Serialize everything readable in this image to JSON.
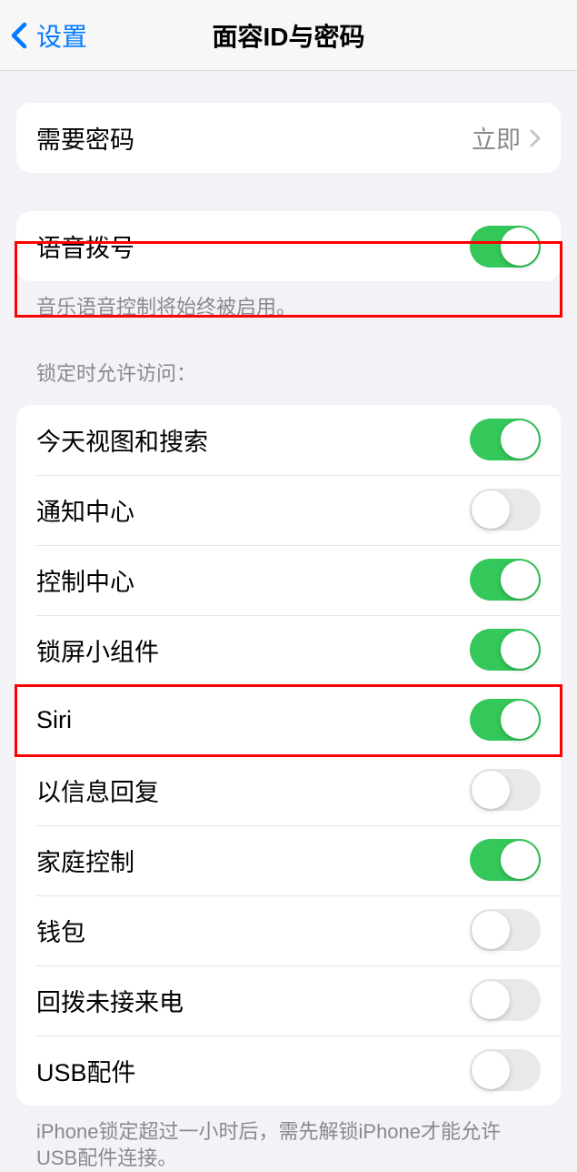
{
  "header": {
    "back_label": "设置",
    "title": "面容ID与密码"
  },
  "passcode_group": {
    "require_passcode": {
      "label": "需要密码",
      "value": "立即"
    }
  },
  "voice_dial": {
    "label": "语音拨号",
    "on": true,
    "footer": "音乐语音控制将始终被启用。"
  },
  "locked_access": {
    "header": "锁定时允许访问：",
    "items": [
      {
        "label": "今天视图和搜索",
        "on": true
      },
      {
        "label": "通知中心",
        "on": false
      },
      {
        "label": "控制中心",
        "on": true
      },
      {
        "label": "锁屏小组件",
        "on": true
      },
      {
        "label": "Siri",
        "on": true
      },
      {
        "label": "以信息回复",
        "on": false
      },
      {
        "label": "家庭控制",
        "on": true
      },
      {
        "label": "钱包",
        "on": false
      },
      {
        "label": "回拨未接来电",
        "on": false
      },
      {
        "label": "USB配件",
        "on": false
      }
    ],
    "footer": "iPhone锁定超过一小时后，需先解锁iPhone才能允许USB配件连接。"
  }
}
